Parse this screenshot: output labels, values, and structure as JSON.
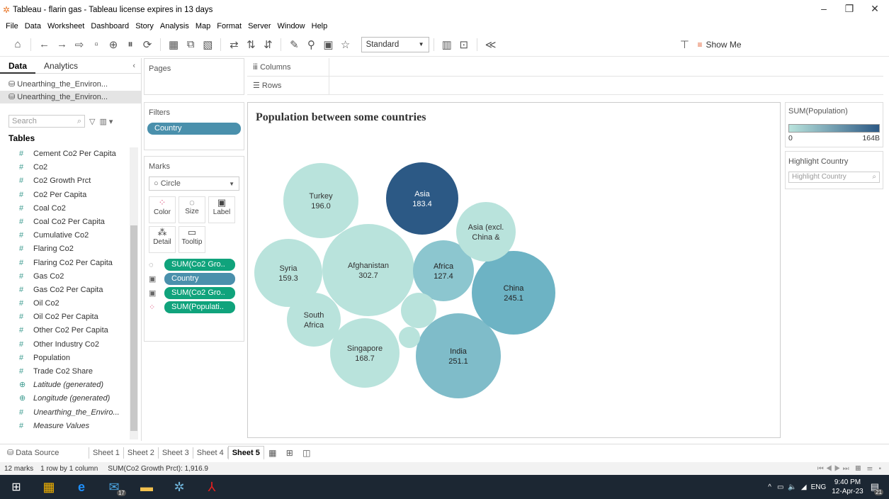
{
  "window": {
    "title": "Tableau - flarin gas - Tableau license expires in 13 days"
  },
  "menu": [
    "File",
    "Data",
    "Worksheet",
    "Dashboard",
    "Story",
    "Analysis",
    "Map",
    "Format",
    "Server",
    "Window",
    "Help"
  ],
  "toolbar": {
    "fit": "Standard",
    "show_me": "Show Me"
  },
  "left_panel": {
    "tabs": [
      "Data",
      "Analytics"
    ],
    "datasources": [
      "Unearthing_the_Environ...",
      "Unearthing_the_Environ..."
    ],
    "search_placeholder": "Search",
    "tables_label": "Tables",
    "fields": [
      {
        "label": "Cement Co2 Per Capita",
        "icon": "#"
      },
      {
        "label": "Co2",
        "icon": "#"
      },
      {
        "label": "Co2 Growth Prct",
        "icon": "#"
      },
      {
        "label": "Co2 Per Capita",
        "icon": "#"
      },
      {
        "label": "Coal Co2",
        "icon": "#"
      },
      {
        "label": "Coal Co2 Per Capita",
        "icon": "#"
      },
      {
        "label": "Cumulative Co2",
        "icon": "#"
      },
      {
        "label": "Flaring Co2",
        "icon": "#"
      },
      {
        "label": "Flaring Co2 Per Capita",
        "icon": "#"
      },
      {
        "label": "Gas Co2",
        "icon": "#"
      },
      {
        "label": "Gas Co2 Per Capita",
        "icon": "#"
      },
      {
        "label": "Oil Co2",
        "icon": "#"
      },
      {
        "label": "Oil Co2 Per Capita",
        "icon": "#"
      },
      {
        "label": "Other Co2 Per Capita",
        "icon": "#"
      },
      {
        "label": "Other Industry Co2",
        "icon": "#"
      },
      {
        "label": "Population",
        "icon": "#"
      },
      {
        "label": "Trade Co2 Share",
        "icon": "#"
      },
      {
        "label": "Latitude (generated)",
        "icon": "⊕",
        "italic": true
      },
      {
        "label": "Longitude (generated)",
        "icon": "⊕",
        "italic": true
      },
      {
        "label": "Unearthing_the_Enviro...",
        "icon": "#",
        "italic": true
      },
      {
        "label": "Measure Values",
        "icon": "#",
        "italic": true
      }
    ]
  },
  "cards": {
    "pages": "Pages",
    "filters": "Filters",
    "filter_pill": "Country",
    "marks": "Marks",
    "mark_type": "Circle",
    "mark_buttons": [
      "Color",
      "Size",
      "Label",
      "Detail",
      "Tooltip"
    ],
    "mark_pills": [
      "SUM(Co2 Gro..",
      "Country",
      "SUM(Co2 Gro..",
      "SUM(Populati.."
    ]
  },
  "shelves": {
    "columns": "Columns",
    "rows": "Rows"
  },
  "legend": {
    "title": "SUM(Population)",
    "min": "0",
    "max": "164B",
    "color_low": "#b9e3dc",
    "color_high": "#2c5985"
  },
  "highlight": {
    "title": "Highlight Country",
    "placeholder": "Highlight Country"
  },
  "chart_data": {
    "type": "packed-bubble",
    "title": "Population between some countries",
    "size_measure": "SUM(Co2 Growth Prct)",
    "color_measure": "SUM(Population)",
    "label_fields": [
      "Country",
      "SUM(Co2 Growth Prct)"
    ],
    "bubbles": [
      {
        "country": "Afghanistan",
        "value": 302.7,
        "label": "302.7"
      },
      {
        "country": "India",
        "value": 251.1,
        "label": "251.1"
      },
      {
        "country": "China",
        "value": 245.1,
        "label": "245.1"
      },
      {
        "country": "Turkey",
        "value": 196.0,
        "label": "196.0"
      },
      {
        "country": "Asia",
        "value": 183.4,
        "label": "183.4"
      },
      {
        "country": "Singapore",
        "value": 168.7,
        "label": "168.7"
      },
      {
        "country": "Syria",
        "value": 159.3,
        "label": "159.3"
      },
      {
        "country": "Africa",
        "value": 127.4,
        "label": "127.4"
      },
      {
        "country": "South Africa",
        "label": ""
      },
      {
        "country": "Asia (excl. China &",
        "label": ""
      },
      {
        "country": "",
        "label": ""
      },
      {
        "country": "",
        "label": ""
      }
    ]
  },
  "sheets": {
    "datasource": "Data Source",
    "tabs": [
      "Sheet 1",
      "Sheet 2",
      "Sheet 3",
      "Sheet 4",
      "Sheet 5"
    ],
    "active": "Sheet 5"
  },
  "status": {
    "marks": "12 marks",
    "rowcol": "1 row by 1 column",
    "sum": "SUM(Co2 Growth Prct): 1,916.9"
  },
  "taskbar": {
    "time": "9:40 PM",
    "date": "12-Apr-23",
    "lang": "ENG",
    "mail_badge": "17",
    "notif_badge": "21"
  }
}
